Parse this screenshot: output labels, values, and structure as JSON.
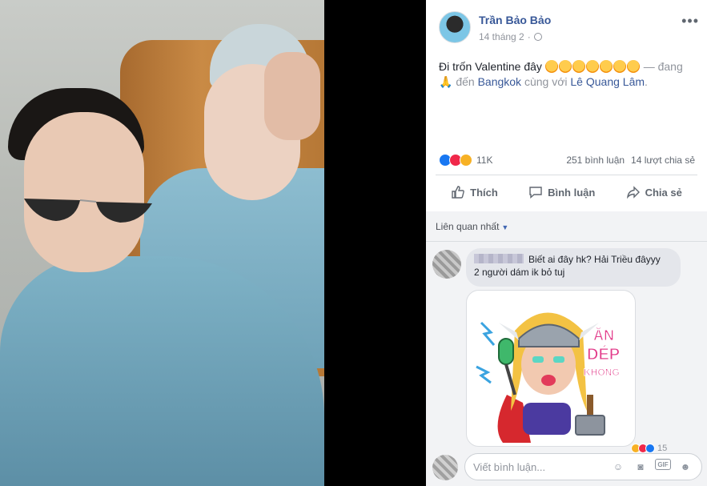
{
  "post": {
    "author": "Trần Bảo Bảo",
    "date": "14 tháng 2",
    "text_main": "Đi trốn Valentine đây",
    "text_dash": " — đang",
    "text_prefix": "đến ",
    "place": "Bangkok",
    "text_with": " cùng với ",
    "tagged": "Lê Quang Lâm",
    "text_end": "."
  },
  "reactions": {
    "count": "11K",
    "comments": "251 bình luận",
    "shares": "14 lượt chia sẻ"
  },
  "actions": {
    "like": "Thích",
    "comment": "Bình luận",
    "share": "Chia sẻ"
  },
  "comments": {
    "sort_label": "Liên quan nhất",
    "items": [
      {
        "line1": "Biết ai đây hk? Hải Triều đâyyy",
        "line2": "2 người dám ik bỏ tuj",
        "mini_react_count": "15"
      }
    ],
    "write_placeholder": "Viết bình luận...",
    "sticker_text": [
      "ĂN",
      "DÉP",
      "KHÔNG"
    ]
  },
  "colors": {
    "link": "#385898",
    "muted": "#90949c",
    "like_blue": "#1877f2"
  }
}
